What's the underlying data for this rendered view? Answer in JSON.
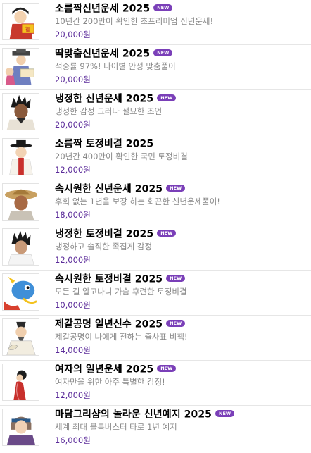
{
  "badge_label": "NEW",
  "accent_color": "#7a3fb8",
  "price_color": "#5b2b9a",
  "items": [
    {
      "title": "소름짝신년운세 2025",
      "desc": "10년간 200만이 확인한 초프리미엄 신년운세!",
      "price": "20,000원",
      "icon": "fortune-teller-with-talisman-icon"
    },
    {
      "title": "딱맞춤신년운세 2025",
      "desc": "적중률 97%! 나이별 안성 맞춤풀이",
      "price": "20,000원",
      "icon": "couple-fortune-icon"
    },
    {
      "title": "냉정한 신년운세 2025",
      "desc": "냉정한 감정 그러나 절묘한 조언",
      "price": "20,000원",
      "icon": "spiky-hair-man-icon"
    },
    {
      "title": "소름짝 토정비결 2025",
      "desc": "20년간 400만이 확인한 국민 토정비결",
      "price": "12,000원",
      "icon": "scholar-in-gat-icon"
    },
    {
      "title": "속시원한 신년운세 2025",
      "desc": "후회 없는 1년을 보장 하는 화끈한 신년운세풀이!",
      "price": "18,000원",
      "icon": "straw-hat-man-icon"
    },
    {
      "title": "냉정한 토정비결 2025",
      "desc": "냉정하고 솔직한 족집게 감정",
      "price": "12,000원",
      "icon": "spiky-hair-man-white-robe-icon"
    },
    {
      "title": "속시원한 토정비결 2025",
      "desc": "모든 걸 알고나니 가슴 후련한 토정비결",
      "price": "10,000원",
      "icon": "blue-dragon-icon"
    },
    {
      "title": "제갈공명 일년신수 2025",
      "desc": "제갈공명이 나에게 전하는 출사표 비책!",
      "price": "14,000원",
      "icon": "zhuge-liang-icon"
    },
    {
      "title": "여자의 일년운세 2025",
      "desc": "여자만을 위한 아주 특별한 감정!",
      "price": "12,000원",
      "icon": "woman-silhouette-icon"
    },
    {
      "title": "마담그리샴의 놀라운 신년예지 2025",
      "desc": "세계 최대 블록버스터 타로 1년 예지",
      "price": "16,000원",
      "icon": "madame-tarot-icon"
    }
  ]
}
